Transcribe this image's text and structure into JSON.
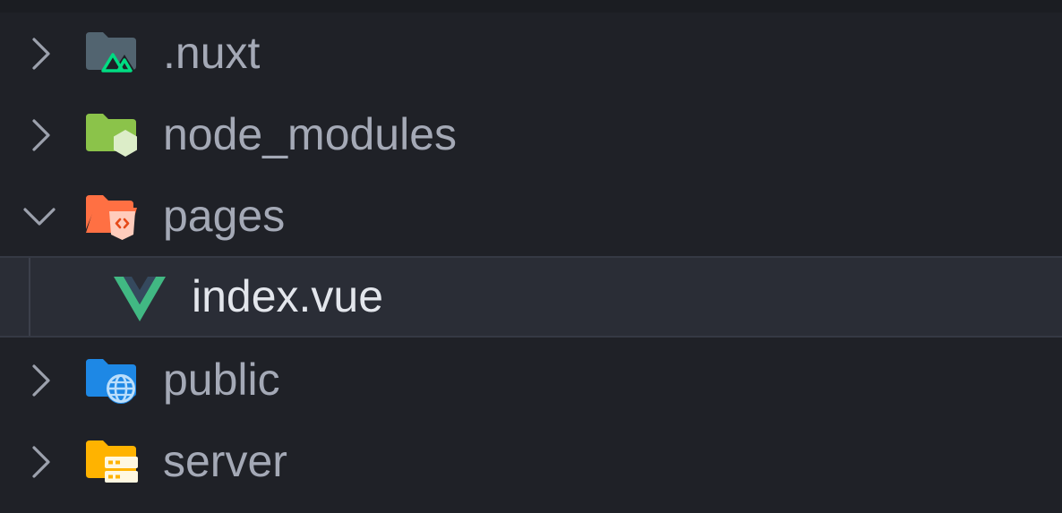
{
  "explorer": {
    "items": [
      {
        "label": ".nuxt",
        "kind": "folder",
        "icon": "nuxt-folder-icon",
        "expanded": false,
        "selected": false,
        "color": "#526470",
        "accent": "#00dc82"
      },
      {
        "label": "node_modules",
        "kind": "folder",
        "icon": "node-modules-folder-icon",
        "expanded": false,
        "selected": false,
        "color": "#8bc34a",
        "accent": "#dcedc8"
      },
      {
        "label": "pages",
        "kind": "folder",
        "icon": "pages-folder-icon",
        "expanded": true,
        "selected": false,
        "color": "#ff7043",
        "accent": "#ffccbc"
      },
      {
        "label": "index.vue",
        "kind": "file",
        "icon": "vue-file-icon",
        "expanded": false,
        "selected": true,
        "color": "#41b883",
        "accent": "#35495e"
      },
      {
        "label": "public",
        "kind": "folder",
        "icon": "public-folder-icon",
        "expanded": false,
        "selected": false,
        "color": "#1e88e5",
        "accent": "#bbdefb"
      },
      {
        "label": "server",
        "kind": "folder",
        "icon": "server-folder-icon",
        "expanded": false,
        "selected": false,
        "color": "#ffb300",
        "accent": "#fff8e1"
      }
    ]
  }
}
